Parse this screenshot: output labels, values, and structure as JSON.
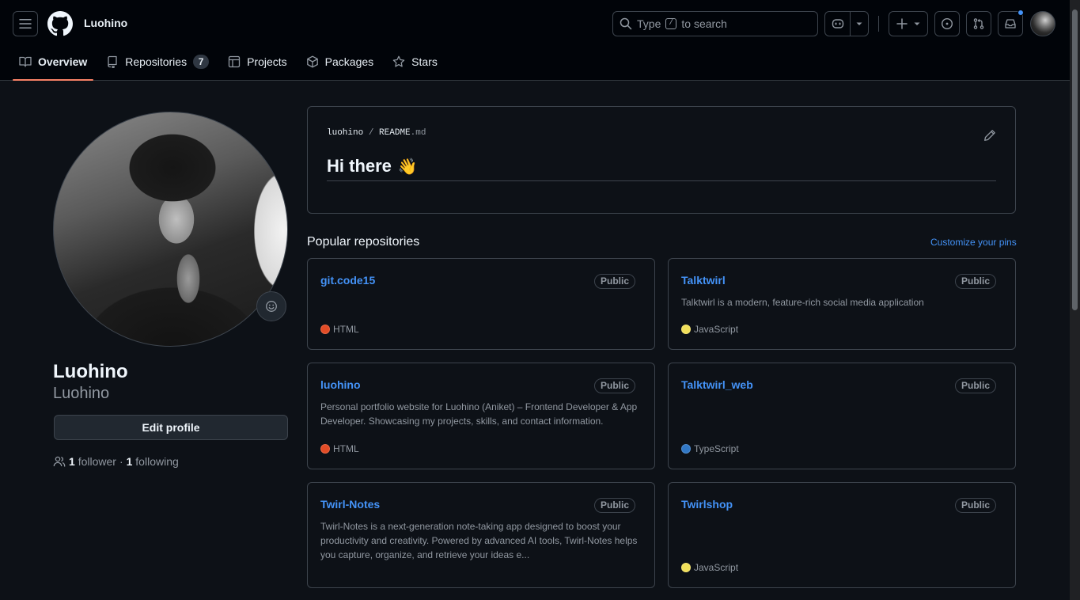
{
  "header": {
    "username": "Luohino",
    "search": {
      "prefix": "Type",
      "key": "/",
      "suffix": "to search"
    }
  },
  "tabs": [
    {
      "label": "Overview",
      "icon": "book-icon",
      "selected": true
    },
    {
      "label": "Repositories",
      "icon": "repo-icon",
      "count": "7"
    },
    {
      "label": "Projects",
      "icon": "table-icon"
    },
    {
      "label": "Packages",
      "icon": "package-icon"
    },
    {
      "label": "Stars",
      "icon": "star-icon"
    }
  ],
  "profile": {
    "name": "Luohino",
    "login": "Luohino",
    "edit_label": "Edit profile",
    "followers": "1",
    "followers_label": "follower",
    "sep": "·",
    "following": "1",
    "following_label": "following"
  },
  "readme": {
    "owner": "luohino",
    "slash": "/",
    "file": "README",
    "ext": ".md",
    "heading": "Hi there",
    "emoji": "👋"
  },
  "popular": {
    "title": "Popular repositories",
    "customize": "Customize your pins",
    "repos": [
      {
        "name": "git.code15",
        "visibility": "Public",
        "description": "",
        "language": "HTML",
        "lang_color": "#e34c26"
      },
      {
        "name": "Talktwirl",
        "visibility": "Public",
        "description": "Talktwirl is a modern, feature-rich social media application",
        "language": "JavaScript",
        "lang_color": "#f1e05a"
      },
      {
        "name": "luohino",
        "visibility": "Public",
        "description": "Personal portfolio website for Luohino (Aniket) – Frontend Developer & App Developer. Showcasing my projects, skills, and contact information.",
        "language": "HTML",
        "lang_color": "#e34c26"
      },
      {
        "name": "Talktwirl_web",
        "visibility": "Public",
        "description": "",
        "language": "TypeScript",
        "lang_color": "#3178c6"
      },
      {
        "name": "Twirl-Notes",
        "visibility": "Public",
        "description": "Twirl-Notes is a next-generation note-taking app designed to boost your productivity and creativity. Powered by advanced AI tools, Twirl-Notes helps you capture, organize, and retrieve your ideas e...",
        "language": "",
        "lang_color": ""
      },
      {
        "name": "Twirlshop",
        "visibility": "Public",
        "description": "",
        "language": "JavaScript",
        "lang_color": "#f1e05a"
      }
    ]
  },
  "colors": {
    "accent": "#4493f8",
    "tab_underline": "#f78166",
    "bg": "#0d1117",
    "header_bg": "#010409"
  }
}
